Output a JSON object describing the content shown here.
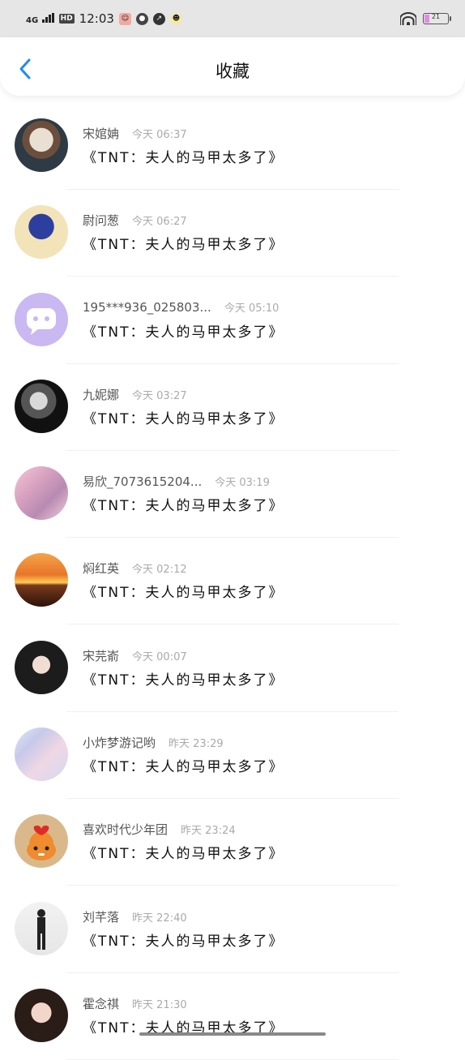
{
  "status_bar": {
    "network": "4G",
    "hd_badge": "HD",
    "time": "12:03",
    "battery_level": "21",
    "battery_fraction": 0.21,
    "battery_color": "#e28be0"
  },
  "header": {
    "title": "收藏"
  },
  "items": [
    {
      "name": "宋婠姌",
      "time": "今天 06:37",
      "content": "《TNT：夫人的马甲太多了》",
      "avatar": "avatar-hanfu-girl"
    },
    {
      "name": "尉问葱",
      "time": "今天 06:27",
      "content": "《TNT：夫人的马甲太多了》",
      "avatar": "avatar-blue-flower"
    },
    {
      "name": "195***936_025803...",
      "time": "今天 05:10",
      "content": "《TNT：夫人的马甲太多了》",
      "avatar": "avatar-default-chat"
    },
    {
      "name": "九妮娜",
      "time": "今天 03:27",
      "content": "《TNT：夫人的马甲太多了》",
      "avatar": "avatar-dark-portrait"
    },
    {
      "name": "易欣_7073615204...",
      "time": "今天 03:19",
      "content": "《TNT：夫人的马甲太多了》",
      "avatar": "avatar-group-photo"
    },
    {
      "name": "焖红英",
      "time": "今天 02:12",
      "content": "《TNT：夫人的马甲太多了》",
      "avatar": "avatar-sunset"
    },
    {
      "name": "宋芫嵛",
      "time": "今天 00:07",
      "content": "《TNT：夫人的马甲太多了》",
      "avatar": "avatar-woman-portrait"
    },
    {
      "name": "小炸梦游记哟",
      "time": "昨天 23:29",
      "content": "《TNT：夫人的马甲太多了》",
      "avatar": "avatar-collage"
    },
    {
      "name": "喜欢时代少年团",
      "time": "昨天 23:24",
      "content": "《TNT：夫人的马甲太多了》",
      "avatar": "avatar-tiger"
    },
    {
      "name": "刘芊落",
      "time": "昨天 22:40",
      "content": "《TNT：夫人的马甲太多了》",
      "avatar": "avatar-standing-figure"
    },
    {
      "name": "霍念祺",
      "time": "昨天 21:30",
      "content": "《TNT：夫人的马甲太多了》",
      "avatar": "avatar-girl-selfie"
    }
  ]
}
